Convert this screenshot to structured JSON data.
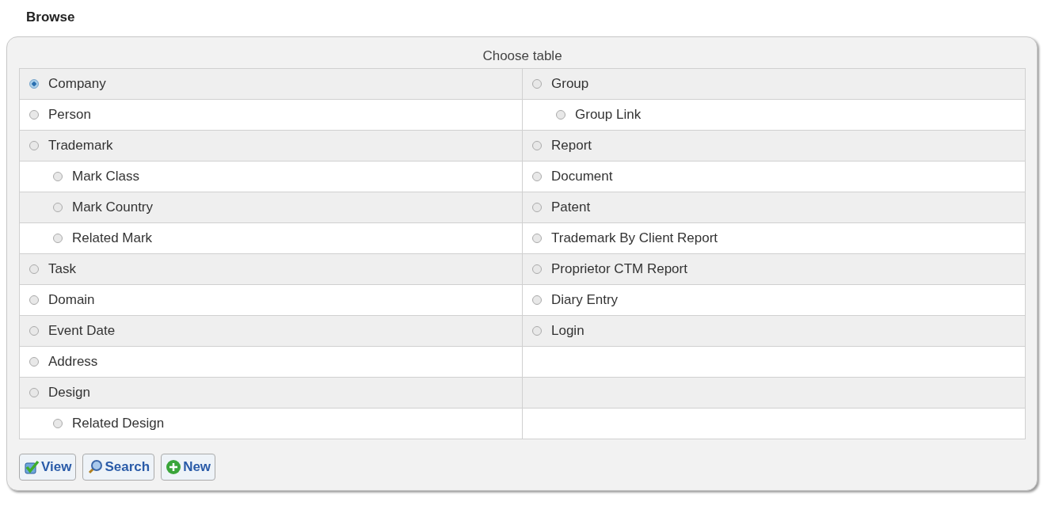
{
  "heading": "Browse",
  "panel": {
    "caption": "Choose table",
    "left_column": [
      {
        "label": "Company",
        "selected": true
      },
      {
        "label": "Person",
        "selected": false
      },
      {
        "label": "Trademark",
        "selected": false,
        "children": [
          {
            "label": "Mark Class",
            "selected": false
          },
          {
            "label": "Mark Country",
            "selected": false
          },
          {
            "label": "Related Mark",
            "selected": false
          }
        ]
      },
      {
        "label": "Task",
        "selected": false
      },
      {
        "label": "Domain",
        "selected": false
      },
      {
        "label": "Event Date",
        "selected": false
      },
      {
        "label": "Address",
        "selected": false
      },
      {
        "label": "Design",
        "selected": false,
        "children": [
          {
            "label": "Related Design",
            "selected": false
          }
        ]
      }
    ],
    "right_column": [
      {
        "label": "Group",
        "selected": false,
        "children": [
          {
            "label": "Group Link",
            "selected": false
          }
        ]
      },
      {
        "label": "Report",
        "selected": false
      },
      {
        "label": "Document",
        "selected": false
      },
      {
        "label": "Patent",
        "selected": false
      },
      {
        "label": "Trademark By Client Report",
        "selected": false
      },
      {
        "label": "Proprietor CTM Report",
        "selected": false
      },
      {
        "label": "Diary Entry",
        "selected": false
      },
      {
        "label": "Login",
        "selected": false
      }
    ],
    "buttons": [
      {
        "kind": "view",
        "label": "View"
      },
      {
        "kind": "search",
        "label": "Search"
      },
      {
        "kind": "new",
        "label": "New"
      }
    ]
  }
}
